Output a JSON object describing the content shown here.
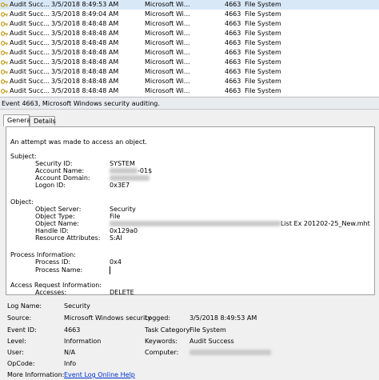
{
  "event_list": {
    "rows": [
      {
        "keyword": "Audit Succ...",
        "datetime": "3/5/2018 8:49:53 AM",
        "source": "Microsoft Wi...",
        "event_id": "4663",
        "task": "File System"
      },
      {
        "keyword": "Audit Succ...",
        "datetime": "3/5/2018 8:49:04 AM",
        "source": "Microsoft Wi...",
        "event_id": "4663",
        "task": "File System"
      },
      {
        "keyword": "Audit Succ...",
        "datetime": "3/5/2018 8:48:48 AM",
        "source": "Microsoft Wi...",
        "event_id": "4663",
        "task": "File System"
      },
      {
        "keyword": "Audit Succ...",
        "datetime": "3/5/2018 8:48:48 AM",
        "source": "Microsoft Wi...",
        "event_id": "4663",
        "task": "File System"
      },
      {
        "keyword": "Audit Succ...",
        "datetime": "3/5/2018 8:48:48 AM",
        "source": "Microsoft Wi...",
        "event_id": "4663",
        "task": "File System"
      },
      {
        "keyword": "Audit Succ...",
        "datetime": "3/5/2018 8:48:48 AM",
        "source": "Microsoft Wi...",
        "event_id": "4663",
        "task": "File System"
      },
      {
        "keyword": "Audit Succ...",
        "datetime": "3/5/2018 8:48:48 AM",
        "source": "Microsoft Wi...",
        "event_id": "4663",
        "task": "File System"
      },
      {
        "keyword": "Audit Succ...",
        "datetime": "3/5/2018 8:48:48 AM",
        "source": "Microsoft Wi...",
        "event_id": "4663",
        "task": "File System"
      },
      {
        "keyword": "Audit Succ...",
        "datetime": "3/5/2018 8:48:48 AM",
        "source": "Microsoft Wi...",
        "event_id": "4663",
        "task": "File System"
      },
      {
        "keyword": "Audit Succ...",
        "datetime": "3/5/2018 8:48:48 AM",
        "source": "Microsoft Wi...",
        "event_id": "4663",
        "task": "File System"
      }
    ]
  },
  "detail": {
    "header": "Event 4663, Microsoft Windows security auditing.",
    "tabs": {
      "general": "General",
      "details": "Details"
    },
    "message": {
      "intro": "An attempt was made to access an object.",
      "subject_heading": "Subject:",
      "security_id_label": "Security ID:",
      "security_id_value": "SYSTEM",
      "account_name_label": "Account Name:",
      "account_name_suffix": "-01$",
      "account_domain_label": "Account Domain:",
      "logon_id_label": "Logon ID:",
      "logon_id_value": "0x3E7",
      "object_heading": "Object:",
      "object_server_label": "Object Server:",
      "object_server_value": "Security",
      "object_type_label": "Object Type:",
      "object_type_value": "File",
      "object_name_label": "Object Name:",
      "object_name_suffix": "List Ex 201202-25_New.mht",
      "handle_id_label": "Handle ID:",
      "handle_id_value": "0x129a0",
      "resource_attributes_label": "Resource Attributes:",
      "resource_attributes_value": "S:AI",
      "process_heading": "Process Information:",
      "process_id_label": "Process ID:",
      "process_id_value": "0x4",
      "process_name_label": "Process Name:",
      "access_heading": "Access Request Information:",
      "accesses_label": "Accesses:",
      "accesses_value": "DELETE"
    },
    "properties": {
      "log_name_label": "Log Name:",
      "log_name_value": "Security",
      "source_label": "Source:",
      "source_value": "Microsoft Windows security",
      "logged_label": "Logged:",
      "logged_value": "3/5/2018 8:49:53 AM",
      "event_id_label": "Event ID:",
      "event_id_value": "4663",
      "task_category_label": "Task Category:",
      "task_category_value": "File System",
      "level_label": "Level:",
      "level_value": "Information",
      "keywords_label": "Keywords:",
      "keywords_value": "Audit Success",
      "user_label": "User:",
      "user_value": "N/A",
      "computer_label": "Computer:",
      "opcode_label": "OpCode:",
      "opcode_value": "Info",
      "more_info_label": "More Information:",
      "more_info_link": "Event Log Online Help"
    }
  },
  "colors": {
    "selected_row": "#d9e8f7",
    "link": "#0033cc",
    "key_icon": "#c9a227"
  },
  "icons": {
    "row_icon": "key-lock-icon"
  }
}
